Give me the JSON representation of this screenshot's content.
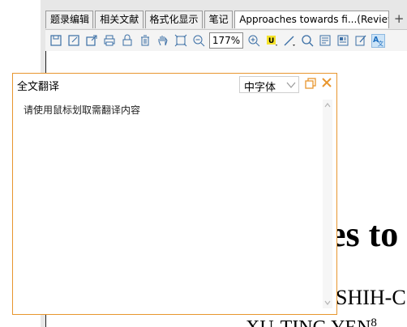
{
  "tabs": [
    {
      "label": "题录编辑",
      "active": false
    },
    {
      "label": "相关文献",
      "active": false
    },
    {
      "label": "格式化显示",
      "active": false
    },
    {
      "label": "笔记",
      "active": false
    },
    {
      "label": "Approaches towards fi...(Review.",
      "active": true
    }
  ],
  "tab_add_label": "+",
  "toolbar": {
    "zoom": "177%",
    "icons": [
      "save-icon",
      "save-as-icon",
      "export-icon",
      "print-icon",
      "lock-icon",
      "delete-icon",
      "hand-icon",
      "fit-page-icon",
      "zoom-out-icon",
      "zoom-in-icon",
      "highlight-icon",
      "line-icon",
      "search-icon",
      "page-view-icon",
      "thumbnail-icon",
      "annotate-icon",
      "translate-icon"
    ]
  },
  "translation_panel": {
    "title": "全文翻译",
    "language": "中字体",
    "placeholder": "请使用鼠标划取需翻译内容",
    "accent_color": "#e8962e"
  },
  "document": {
    "title_fragment": "es to",
    "author_line1": "SHIH-C",
    "author_line2": "XU-TING YEN",
    "author_line2_sup": "8"
  }
}
